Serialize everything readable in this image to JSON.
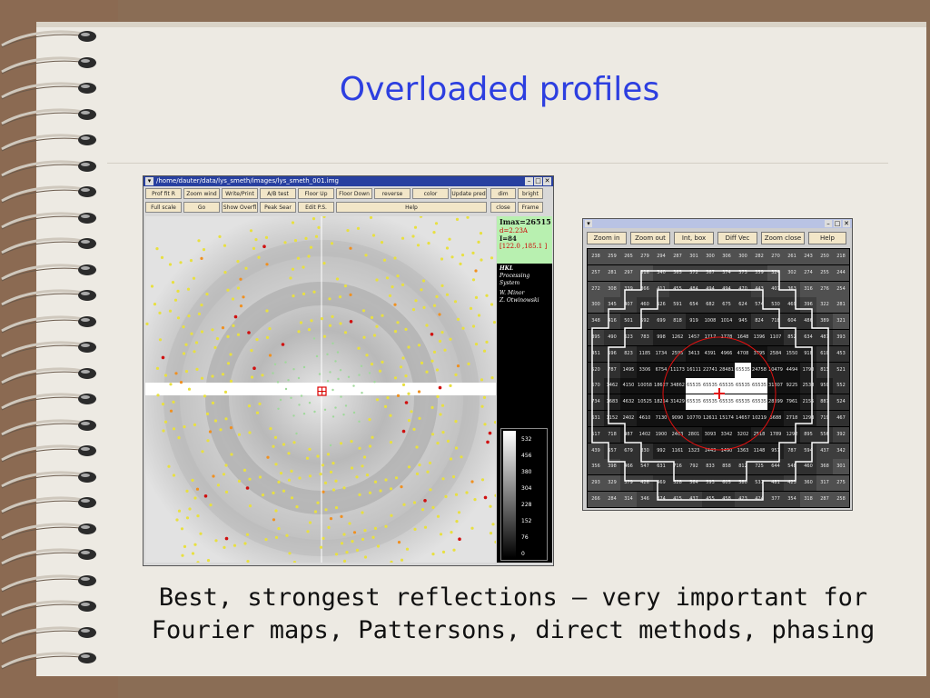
{
  "slide": {
    "title": "Overloaded profiles",
    "caption_line1": "Best, strongest reflections – very important for",
    "caption_line2": "Fourier maps, Pattersons, direct methods, phasing"
  },
  "left_window": {
    "title": "/home/dauter/data/lys_smeth/images/lys_smeth_001.img",
    "title_buttons": [
      "–",
      "□",
      "✕"
    ],
    "row1": [
      "Prof fit R",
      "Zoom wind",
      "Write/Print",
      "A/B test",
      "Floor Up",
      "Floor Down",
      "reverse",
      "color",
      "Update pred",
      "dim",
      "bright"
    ],
    "row2": [
      "Full scale",
      "Go",
      "Show Overfl",
      "Peak Sear",
      "Edit P.S.",
      "Help",
      "close",
      "Frame"
    ],
    "info": {
      "imax": "Imax=26515",
      "resolution": "d=2.23A",
      "intensity": "I=84",
      "coords": "[122.0 ,185.1 ]"
    },
    "hkl_lines": [
      "HKL",
      "Processing",
      "System",
      "W. Minor",
      "Z. Otwinowski"
    ],
    "scale_labels": [
      "532",
      "456",
      "380",
      "304",
      "228",
      "152",
      "76",
      "0"
    ]
  },
  "right_window": {
    "title_buttons": [
      "–",
      "□",
      "✕"
    ],
    "buttons": [
      "Zoom in",
      "Zoom out",
      "Int, box",
      "Diff Vec",
      "Zoom close",
      "Help"
    ],
    "grid": [
      [
        "238",
        "259",
        "265",
        "279",
        "294",
        "287",
        "301",
        "300",
        "306",
        "300",
        "282",
        "270",
        "261",
        "243",
        "250",
        "218"
      ],
      [
        "257",
        "281",
        "297",
        "316",
        "340",
        "365",
        "372",
        "367",
        "374",
        "373",
        "359",
        "324",
        "302",
        "274",
        "255",
        "244"
      ],
      [
        "272",
        "308",
        "339",
        "366",
        "411",
        "455",
        "484",
        "494",
        "494",
        "470",
        "443",
        "407",
        "363",
        "316",
        "276",
        "254"
      ],
      [
        "300",
        "345",
        "407",
        "460",
        "526",
        "591",
        "654",
        "682",
        "675",
        "624",
        "574",
        "530",
        "469",
        "396",
        "322",
        "281"
      ],
      [
        "348",
        "416",
        "501",
        "592",
        "699",
        "818",
        "919",
        "1008",
        "1014",
        "945",
        "824",
        "718",
        "604",
        "486",
        "389",
        "321"
      ],
      [
        "395",
        "490",
        "623",
        "783",
        "998",
        "1262",
        "1457",
        "1717",
        "1778",
        "1648",
        "1396",
        "1107",
        "852",
        "634",
        "487",
        "393"
      ],
      [
        "451",
        "596",
        "823",
        "1185",
        "1734",
        "2595",
        "3413",
        "4391",
        "4966",
        "4708",
        "3795",
        "2584",
        "1550",
        "918",
        "610",
        "453"
      ],
      [
        "520",
        "787",
        "1495",
        "3306",
        "6754",
        "11173",
        "16111",
        "22741",
        "28481",
        "65535",
        "24758",
        "10479",
        "4494",
        "1790",
        "813",
        "521"
      ],
      [
        "670",
        "1462",
        "4150",
        "10058",
        "18627",
        "34862",
        "65535",
        "65535",
        "65535",
        "65535",
        "65535",
        "31307",
        "9225",
        "2538",
        "950",
        "552"
      ],
      [
        "734",
        "1683",
        "4632",
        "10525",
        "18254",
        "31429",
        "65535",
        "65535",
        "65535",
        "65535",
        "65535",
        "28399",
        "7961",
        "2155",
        "887",
        "524"
      ],
      [
        "631",
        "1152",
        "2402",
        "4610",
        "7130",
        "9090",
        "10770",
        "12611",
        "15174",
        "14657",
        "10219",
        "5688",
        "2718",
        "1293",
        "719",
        "467"
      ],
      [
        "517",
        "718",
        "987",
        "1402",
        "1900",
        "2403",
        "2801",
        "3093",
        "3342",
        "3202",
        "2518",
        "1789",
        "1292",
        "895",
        "556",
        "392"
      ],
      [
        "439",
        "557",
        "679",
        "830",
        "992",
        "1161",
        "1323",
        "1443",
        "1490",
        "1363",
        "1148",
        "957",
        "787",
        "594",
        "437",
        "342"
      ],
      [
        "356",
        "398",
        "466",
        "547",
        "631",
        "716",
        "792",
        "833",
        "858",
        "812",
        "725",
        "644",
        "548",
        "460",
        "368",
        "301"
      ],
      [
        "293",
        "329",
        "379",
        "426",
        "469",
        "528",
        "564",
        "593",
        "605",
        "580",
        "537",
        "481",
        "423",
        "360",
        "317",
        "275"
      ],
      [
        "266",
        "284",
        "314",
        "346",
        "374",
        "415",
        "437",
        "455",
        "458",
        "423",
        "424",
        "377",
        "354",
        "318",
        "287",
        "258"
      ]
    ],
    "colors": {
      "overload": "#ffffff",
      "box": "#ffffff",
      "circle": "#e01010"
    }
  },
  "colors": {
    "title": "#2d3fe0",
    "frame": "#8b6a52",
    "page": "#edeae3"
  }
}
